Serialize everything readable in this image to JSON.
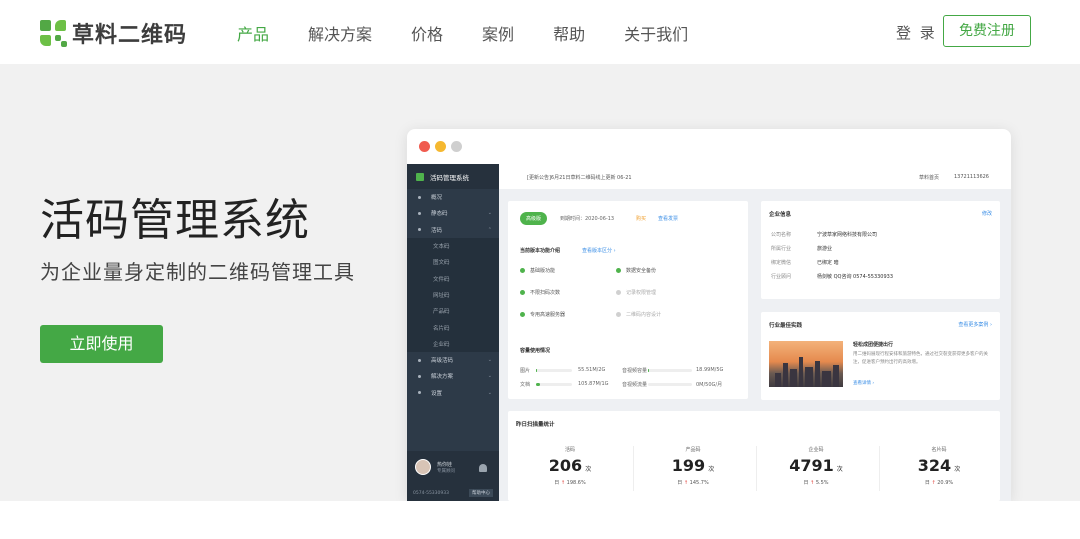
{
  "nav": {
    "logo_text": "草料二维码",
    "links": [
      "产品",
      "解决方案",
      "价格",
      "案例",
      "帮助",
      "关于我们"
    ],
    "active_index": 0,
    "login": "登 录",
    "register": "免费注册",
    "accent": "#44a845"
  },
  "hero": {
    "title": "活码管理系统",
    "subtitle": "为企业量身定制的二维码管理工具",
    "cta": "立即使用"
  },
  "mock": {
    "sidebar": {
      "title": "活码管理系统",
      "items": [
        "概况",
        "静态码",
        "活码",
        "文本码",
        "图文码",
        "文件码",
        "网址码",
        "产品码",
        "名片码",
        "企业码",
        "高级活码",
        "解决方案",
        "设置"
      ],
      "user_name": "热你娃",
      "user_role": "专属顾问",
      "phone": "0574-55330933",
      "help": "帮助中心"
    },
    "topbar": {
      "notice": "[更新公告]6月21日草料二维码线上更新 06-21",
      "home": "草料首页",
      "phone": "13721113626"
    },
    "plan": {
      "badge": "高级版",
      "expire": "到期时间：2020-06-13",
      "buy": "购买",
      "renew": "查看发票",
      "features_title": "当前版本功能介绍",
      "features_link": "查看版本区分 ›",
      "features": [
        {
          "label": "基础版功能",
          "on": true
        },
        {
          "label": "数据安全备份",
          "on": true
        },
        {
          "label": "不限扫码次数",
          "on": true
        },
        {
          "label": "记录权限管理",
          "on": false
        },
        {
          "label": "专用高速服务器",
          "on": true
        },
        {
          "label": "二维码内容设计",
          "on": false
        }
      ],
      "storage_title": "容量使用情况",
      "storage": [
        {
          "label": "图片",
          "value": "55.51M/2G",
          "fill": 0.03
        },
        {
          "label": "音视频容量",
          "value": "18.99M/5G",
          "fill": 0.01
        },
        {
          "label": "文档",
          "value": "105.87M/1G",
          "fill": 0.1
        },
        {
          "label": "音视频流量",
          "value": "0M/50G/月",
          "fill": 0.0
        }
      ]
    },
    "company": {
      "title": "企业信息",
      "edit": "修改",
      "rows": [
        {
          "k": "公司名称",
          "v": "宁波草家网络科技有限公司"
        },
        {
          "k": "所属行业",
          "v": "旅游业"
        },
        {
          "k": "绑定微信",
          "v": "已绑定 暗"
        },
        {
          "k": "行业顾问",
          "v": "杨剑敏    QQ咨询    0574-55330933"
        }
      ]
    },
    "case": {
      "title": "行业最佳实践",
      "more": "查看更多案例 ›",
      "item_title": "轻松成团便捷出行",
      "item_desc": "用二维码展现行程安排和旅游特色，通过社交裂变获得更多客户的关注，促进客户预约出行的高效增。",
      "item_more": "查看详情 ›"
    },
    "stats": {
      "title": "昨日扫描量统计",
      "unit": "次",
      "items": [
        {
          "name": "活码",
          "num": "206",
          "day": "198.6%"
        },
        {
          "name": "产品码",
          "num": "199",
          "day": "145.7%"
        },
        {
          "name": "企业码",
          "num": "4791",
          "day": "5.5%"
        },
        {
          "name": "名片码",
          "num": "324",
          "day": "20.9%"
        }
      ],
      "day_label": "日",
      "up_icon": "arrow-up-icon"
    }
  }
}
